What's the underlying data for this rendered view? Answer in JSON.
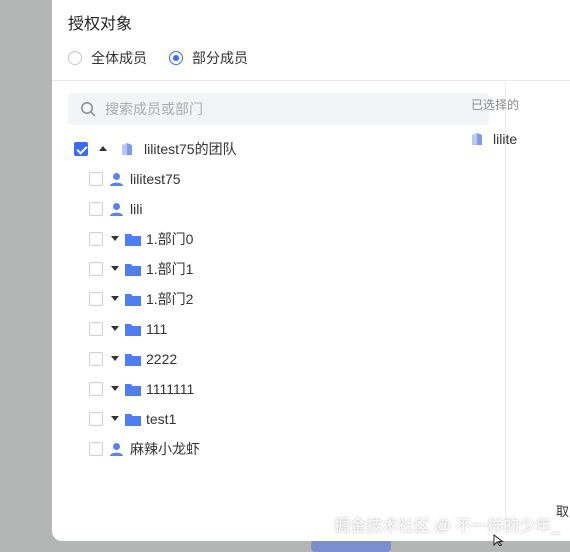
{
  "dialog": {
    "title": "授权对象",
    "radio_options": [
      {
        "label": "全体成员",
        "checked": false
      },
      {
        "label": "部分成员",
        "checked": true
      }
    ],
    "search": {
      "placeholder": "搜索成员或部门",
      "value": ""
    },
    "tree": {
      "root": {
        "label": "lilitest75的团队",
        "checked": true,
        "expanded": true
      },
      "children": [
        {
          "label": "lilitest75",
          "type": "user",
          "checked": false
        },
        {
          "label": "lili",
          "type": "user",
          "checked": false
        },
        {
          "label": "1.部门0",
          "type": "department",
          "checked": false
        },
        {
          "label": "1.部门1",
          "type": "department",
          "checked": false
        },
        {
          "label": "1.部门2",
          "type": "department",
          "checked": false
        },
        {
          "label": "111",
          "type": "department",
          "checked": false
        },
        {
          "label": "2222",
          "type": "department",
          "checked": false
        },
        {
          "label": "1111111",
          "type": "department",
          "checked": false
        },
        {
          "label": "test1",
          "type": "department",
          "checked": false
        },
        {
          "label": "麻辣小龙虾",
          "type": "user",
          "checked": false
        }
      ]
    },
    "selected_panel": {
      "title": "已选择的",
      "items": [
        {
          "label": "lilite"
        }
      ]
    },
    "cancel_label": "取"
  },
  "watermark": "掘金技术社区 @ 不一样的少年_",
  "colors": {
    "accent": "#3a6bf1",
    "icon_blue": "#5d82ee",
    "backdrop": "#b4b6b5"
  }
}
